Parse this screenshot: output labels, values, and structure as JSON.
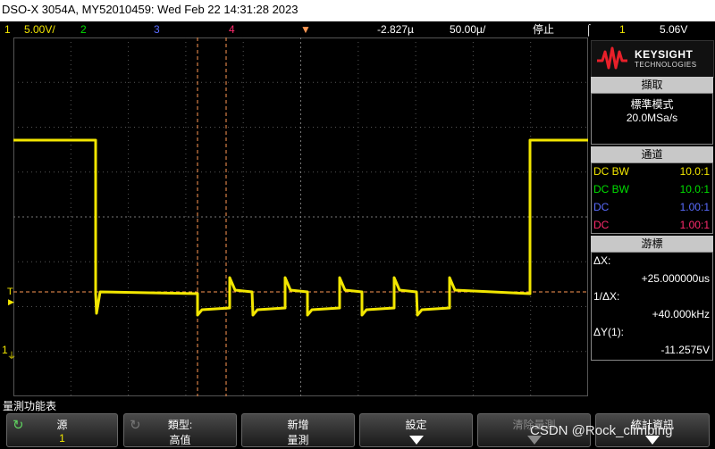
{
  "titlebar": {
    "text": "DSO-X 3054A, MY52010459: Wed Feb 22 14:31:28 2023"
  },
  "status": {
    "ch1_num": "1",
    "ch1_scale": "5.00V/",
    "ch2_num": "2",
    "ch3_num": "3",
    "ch4_num": "4",
    "time_offset": "-2.827µ",
    "time_scale": "50.00µ/",
    "run_state": "停止",
    "trig_ch": "1",
    "trig_level": "5.06V"
  },
  "brand": {
    "name": "KEYSIGHT",
    "sub": "TECHNOLOGIES"
  },
  "acquire": {
    "header": "擷取",
    "mode": "標準模式",
    "rate": "20.0MSa/s"
  },
  "channels": {
    "header": "通道",
    "items": [
      {
        "coupling": "DC BW",
        "ratio": "10.0:1",
        "color": "#f2e600"
      },
      {
        "coupling": "DC BW",
        "ratio": "10.0:1",
        "color": "#00dd00"
      },
      {
        "coupling": "DC",
        "ratio": "1.00:1",
        "color": "#5a6cff"
      },
      {
        "coupling": "DC",
        "ratio": "1.00:1",
        "color": "#ff2a6d"
      }
    ]
  },
  "cursors": {
    "header": "游標",
    "dx_label": "ΔX:",
    "dx_value": "+25.000000us",
    "inv_label": "1/ΔX:",
    "inv_value": "+40.000kHz",
    "dy_label": "ΔY(1):",
    "dy_value": "-11.2575V"
  },
  "measure_menu_label": "量測功能表",
  "softkeys": {
    "source_l1": "源",
    "source_l2": "1",
    "type_l1": "類型:",
    "type_l2": "高值",
    "add_l1": "新增",
    "add_l2": "量測",
    "settings_l1": "設定",
    "clear_l1": "清除量測",
    "stats_l1": "統計資訊"
  },
  "watermark": "CSDN @Rock_climbing",
  "marker_T": "T",
  "marker_1": "1",
  "colors": {
    "ch1": "#f2e600",
    "cursor": "#ff9955",
    "grid": "#555555"
  }
}
